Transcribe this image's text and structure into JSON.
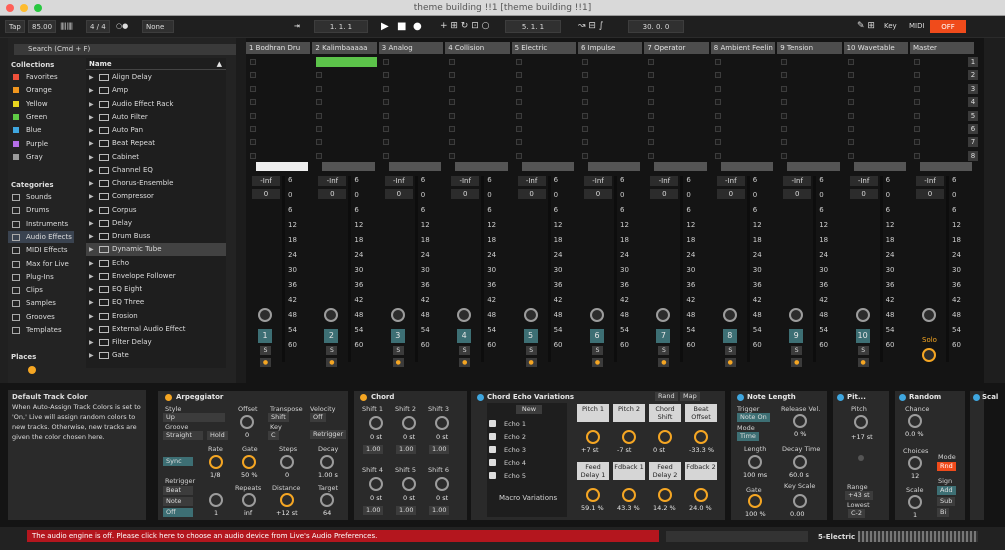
{
  "window": {
    "title": "theme building !!1  [theme building !!1]"
  },
  "transport": {
    "tap": "Tap",
    "bpm": "85.00",
    "sig": "4 / 4",
    "metro": "○●",
    "quant": "None",
    "pos": "1.   1.   1",
    "loop_start": "5.   1.   1",
    "loop_len": "30.   0.   0",
    "key": "Key",
    "midi": "MIDI",
    "off": "OFF"
  },
  "browser": {
    "search": "Search (Cmd + F)",
    "collections_head": "Collections",
    "collections": [
      {
        "label": "Favorites",
        "color": "#f0513b"
      },
      {
        "label": "Orange",
        "color": "#f0961e"
      },
      {
        "label": "Yellow",
        "color": "#e9d51f"
      },
      {
        "label": "Green",
        "color": "#5fcb45"
      },
      {
        "label": "Blue",
        "color": "#3fa7e0"
      },
      {
        "label": "Purple",
        "color": "#b46ee8"
      },
      {
        "label": "Gray",
        "color": "#9a9a9a"
      }
    ],
    "categories_head": "Categories",
    "categories": [
      "Sounds",
      "Drums",
      "Instruments",
      "Audio Effects",
      "MIDI Effects",
      "Max for Live",
      "Plug-Ins",
      "Clips",
      "Samples",
      "Grooves",
      "Templates"
    ],
    "places_head": "Places",
    "name_head": "Name",
    "items": [
      "Align Delay",
      "Amp",
      "Audio Effect Rack",
      "Auto Filter",
      "Auto Pan",
      "Beat Repeat",
      "Cabinet",
      "Channel EQ",
      "Chorus-Ensemble",
      "Compressor",
      "Corpus",
      "Delay",
      "Drum Buss",
      "Dynamic Tube",
      "Echo",
      "Envelope Follower",
      "EQ Eight",
      "EQ Three",
      "Erosion",
      "External Audio Effect",
      "Filter Delay",
      "Gate"
    ]
  },
  "tracks": [
    {
      "name": "1 Bodhran Dru",
      "num": "1",
      "color": "#3d6f74"
    },
    {
      "name": "2 Kalimbaaaaa",
      "num": "2",
      "color": "#3d6f74"
    },
    {
      "name": "3 Analog",
      "num": "3",
      "color": "#3d6f74"
    },
    {
      "name": "4 Collision",
      "num": "4",
      "color": "#3d6f74"
    },
    {
      "name": "5 Electric",
      "num": "5",
      "color": "#3d6f74"
    },
    {
      "name": "6 Impulse",
      "num": "6",
      "color": "#3d6f74"
    },
    {
      "name": "7 Operator",
      "num": "7",
      "color": "#3d6f74"
    },
    {
      "name": "8 Ambient Feelin",
      "num": "8",
      "color": "#3d6f74"
    },
    {
      "name": "9 Tension",
      "num": "9",
      "color": "#3d6f74"
    },
    {
      "name": "10 Wavetable",
      "num": "10",
      "color": "#3d6f74"
    },
    {
      "name": "Master",
      "num": "",
      "color": ""
    }
  ],
  "mixer": {
    "inf": "-Inf",
    "zero": "0",
    "ticks": [
      "6",
      "0",
      "6",
      "12",
      "18",
      "24",
      "30",
      "36",
      "42",
      "48",
      "54",
      "60"
    ],
    "solo": "Solo",
    "s": "S"
  },
  "clip": {
    "name": ""
  },
  "scenes": [
    "1",
    "2",
    "3",
    "4",
    "5",
    "6",
    "7",
    "8"
  ],
  "info": {
    "title": "Default Track Color",
    "text": "When Auto-Assign Track Colors is set to 'On,' Live will assign random colors to new tracks. Otherwise, new tracks are given the color chosen here."
  },
  "arp": {
    "title": "Arpeggiator",
    "style_l": "Style",
    "style_v": "Up",
    "groove_l": "Groove",
    "groove_v": "Straight",
    "hold": "Hold",
    "offset_l": "Offset",
    "offset_v": "0",
    "transpose_l": "Transpose",
    "transpose_v": "Shift",
    "key_l": "Key",
    "key_v": "C",
    "velocity_l": "Velocity",
    "velocity_v": "Off",
    "retrigger_btn": "Retrigger",
    "sync": "Sync",
    "rate_l": "Rate",
    "rate_v": "1/8",
    "gate_l": "Gate",
    "gate_v": "50 %",
    "steps_l": "Steps",
    "steps_v": "0",
    "decay_l": "Decay",
    "decay_v": "1.00 s",
    "retrig_l": "Retrigger",
    "beat": "Beat",
    "note": "Note",
    "off": "Off",
    "one": "1",
    "repeats_l": "Repeats",
    "repeats_v": "inf",
    "distance_l": "Distance",
    "distance_v": "+12 st",
    "target_l": "Target",
    "target_v": "64"
  },
  "chord": {
    "title": "Chord",
    "shifts": [
      {
        "l": "Shift 1",
        "v": "0 st",
        "g": "1.00"
      },
      {
        "l": "Shift 2",
        "v": "0 st",
        "g": "1.00"
      },
      {
        "l": "Shift 3",
        "v": "0 st",
        "g": "1.00"
      },
      {
        "l": "Shift 4",
        "v": "0 st",
        "g": "1.00"
      },
      {
        "l": "Shift 5",
        "v": "0 st",
        "g": "1.00"
      },
      {
        "l": "Shift 6",
        "v": "0 st",
        "g": "1.00"
      }
    ]
  },
  "echo": {
    "title": "Chord Echo Variations",
    "rand": "Rand",
    "map": "Map",
    "new": "New",
    "chains": [
      "Echo 1",
      "Echo 2",
      "Echo 3",
      "Echo 4",
      "Echo 5"
    ],
    "macro": "Macro Variations",
    "macros": [
      {
        "l": "Pitch 1",
        "v": "+7 st"
      },
      {
        "l": "Pitch 2",
        "v": "-7 st"
      },
      {
        "l": "Chord Shift",
        "v": "0 st"
      },
      {
        "l": "Beat Offset",
        "v": "-33.3 %"
      },
      {
        "l": "Feed Delay 1",
        "v": "59.1 %"
      },
      {
        "l": "Fdback 1",
        "v": "43.3 %"
      },
      {
        "l": "Feed Delay 2",
        "v": "14.2 %"
      },
      {
        "l": "Fdback 2",
        "v": "24.0 %"
      }
    ]
  },
  "notelen": {
    "title": "Note Length",
    "trigger_l": "Trigger",
    "trigger_v": "Note On",
    "mode_l": "Mode",
    "mode_v": "Time",
    "release_l": "Release Vel.",
    "release_v": "0 %",
    "length_l": "Length",
    "length_v": "100 ms",
    "decay_l": "Decay Time",
    "decay_v": "60.0 s",
    "gate_l": "Gate",
    "gate_v": "100 %",
    "keyscale_l": "Key Scale",
    "keyscale_v": "0.00"
  },
  "pitch": {
    "title": "Pit...",
    "pitch_l": "Pitch",
    "pitch_v": "+17 st",
    "range_l": "Range",
    "range_v": "+43 st",
    "lowest_l": "Lowest",
    "lowest_v": "C-2"
  },
  "random": {
    "title": "Random",
    "chance_l": "Chance",
    "chance_v": "0.0 %",
    "choices_l": "Choices",
    "choices_v": "12",
    "scale_l": "Scale",
    "scale_v": "1",
    "mode_l": "Mode",
    "mode_v": "Rnd",
    "sign_l": "Sign",
    "add": "Add",
    "sub": "Sub",
    "bi": "Bi"
  },
  "scale_dev": {
    "title": "Scal"
  },
  "status": {
    "warning": "The audio engine is off. Please click here to choose an audio device from Live's Audio Preferences.",
    "track": "5-Electric"
  }
}
